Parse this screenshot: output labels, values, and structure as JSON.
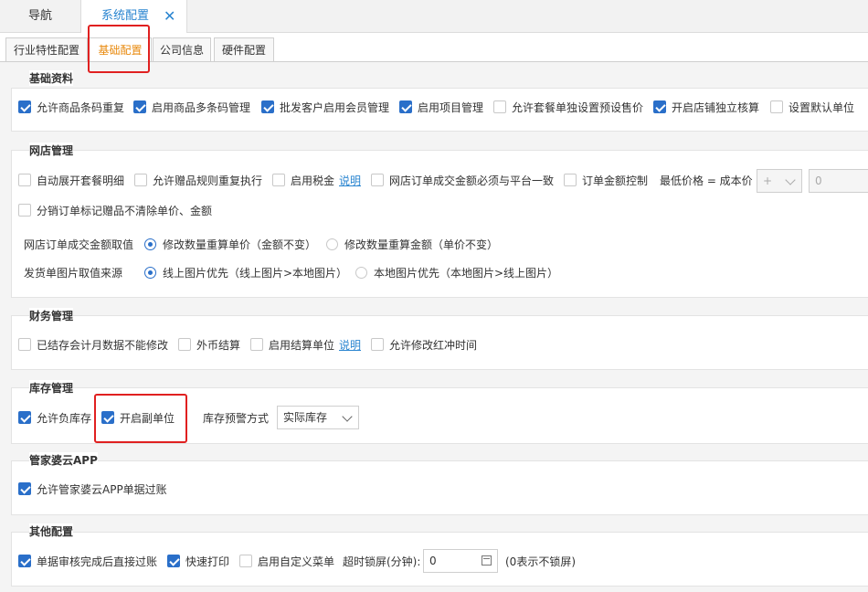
{
  "topbar": {
    "nav_tab": "导航",
    "active_tab": "系统配置",
    "close_symbol": "✕"
  },
  "subtabs": [
    "行业特性配置",
    "基础配置",
    "公司信息",
    "硬件配置"
  ],
  "sections": {
    "basic": {
      "title": "基础资料",
      "items": [
        {
          "label": "允许商品条码重复",
          "checked": true
        },
        {
          "label": "启用商品多条码管理",
          "checked": true
        },
        {
          "label": "批发客户启用会员管理",
          "checked": true
        },
        {
          "label": "启用项目管理",
          "checked": true
        },
        {
          "label": "允许套餐单独设置预设售价",
          "checked": false
        },
        {
          "label": "开启店铺独立核算",
          "checked": true
        },
        {
          "label": "设置默认单位",
          "checked": false
        }
      ]
    },
    "online": {
      "title": "网店管理",
      "items": [
        {
          "label": "自动展开套餐明细",
          "checked": false
        },
        {
          "label": "允许赠品规则重复执行",
          "checked": false
        },
        {
          "label": "启用税金",
          "checked": false
        },
        {
          "label": "网店订单成交金额必须与平台一致",
          "checked": false
        },
        {
          "label": "订单金额控制",
          "checked": false
        }
      ],
      "tax_link": "说明",
      "price_rule_label": "最低价格 = 成本价",
      "op_value": "+",
      "amount_value": "0",
      "item2": {
        "label": "分销订单标记赠品不清除单价、金额",
        "checked": false
      },
      "deal_amount_label": "网店订单成交金额取值",
      "deal_amount_options": [
        "修改数量重算单价（金额不变）",
        "修改数量重算金额（单价不变）"
      ],
      "image_label": "发货单图片取值来源",
      "image_options": [
        "线上图片优先（线上图片>本地图片）",
        "本地图片优先（本地图片>线上图片）"
      ]
    },
    "finance": {
      "title": "财务管理",
      "items": [
        {
          "label": "已结存会计月数据不能修改",
          "checked": false
        },
        {
          "label": "外币结算",
          "checked": false
        },
        {
          "label": "启用结算单位",
          "checked": false
        },
        {
          "label": "允许修改红冲时间",
          "checked": false
        }
      ],
      "link": "说明"
    },
    "stock": {
      "title": "库存管理",
      "items": [
        {
          "label": "允许负库存",
          "checked": true
        },
        {
          "label": "开启副单位",
          "checked": true
        }
      ],
      "warn_label": "库存预警方式",
      "warn_value": "实际库存"
    },
    "app": {
      "title": "管家婆云APP",
      "items": [
        {
          "label": "允许管家婆云APP单据过账",
          "checked": true
        }
      ]
    },
    "other": {
      "title": "其他配置",
      "items": [
        {
          "label": "单据审核完成后直接过账",
          "checked": true
        },
        {
          "label": "快速打印",
          "checked": true
        },
        {
          "label": "启用自定义菜单",
          "checked": false
        }
      ],
      "lock_label": "超时锁屏(分钟):",
      "lock_value": "0",
      "lock_hint": "(0表示不锁屏)"
    }
  },
  "colors": {
    "accent": "#2a6fc9",
    "active_subtab": "#e8890c",
    "highlight": "#e02020"
  }
}
